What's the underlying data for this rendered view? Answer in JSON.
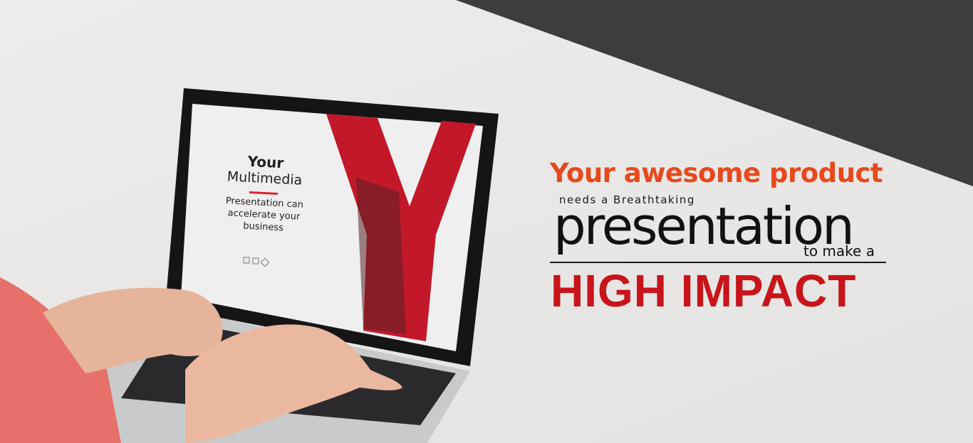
{
  "banner": {
    "line1": "Your awesome product",
    "line2": "needs a Breathtaking",
    "line3": "presentation",
    "line4": "to make a",
    "line5": "HIGH IMPACT"
  },
  "laptop_screen": {
    "title_line1": "Your",
    "title_line2": "Multimedia",
    "body_line1": "Presentation can",
    "body_line2": "accelerate your",
    "body_line3": "business"
  },
  "colors": {
    "accent_orange": "#e8481c",
    "accent_red": "#c8141a",
    "slide_red": "#d8252f",
    "dark_corner": "#3d3d3d"
  }
}
